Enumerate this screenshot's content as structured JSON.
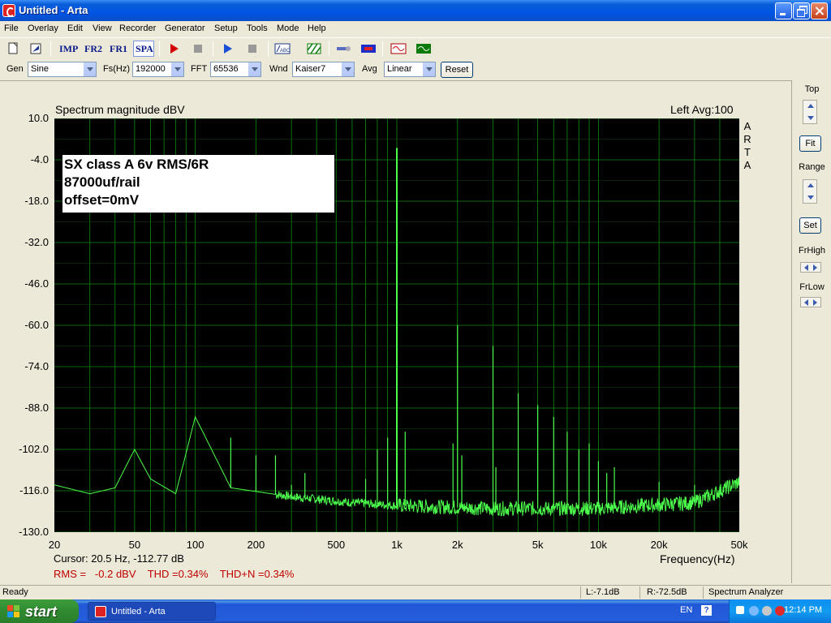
{
  "window": {
    "title": "Untitled - Arta"
  },
  "menu": [
    "File",
    "Overlay",
    "Edit",
    "View",
    "Recorder",
    "Generator",
    "Setup",
    "Tools",
    "Mode",
    "Help"
  ],
  "toolbar": {
    "imp": "IMP",
    "fr2": "FR2",
    "fr1": "FR1",
    "spa": "SPA"
  },
  "controls": {
    "gen_label": "Gen",
    "gen_value": "Sine",
    "fs_label": "Fs(Hz)",
    "fs_value": "192000",
    "fft_label": "FFT",
    "fft_value": "65536",
    "wnd_label": "Wnd",
    "wnd_value": "Kaiser7",
    "avg_label": "Avg",
    "avg_value": "Linear",
    "reset_label": "Reset"
  },
  "plot": {
    "title": "Spectrum magnitude dBV",
    "channel": "Left  Avg:100",
    "vertical_brand": [
      "A",
      "R",
      "T",
      "A"
    ],
    "overlay_lines": [
      "SX class A 6v RMS/6R",
      "87000uf/rail",
      "offset=0mV"
    ],
    "xlabel": "Frequency(Hz)",
    "cursor": "Cursor:    20.5 Hz, -112.77 dB",
    "measurements": "RMS =   -0.2 dBV    THD =0.34%    THD+N =0.34%"
  },
  "side": {
    "top": "Top",
    "fit": "Fit",
    "range": "Range",
    "set": "Set",
    "frhigh": "FrHigh",
    "frlow": "FrLow"
  },
  "status": {
    "ready": "Ready",
    "left": "L:-7.1dB",
    "right": "R:-72.5dB",
    "mode": "Spectrum Analyzer"
  },
  "taskbar": {
    "start": "start",
    "item": "Untitled - Arta",
    "lang": "EN",
    "clock": "12:14 PM"
  },
  "colors": {
    "plot_bg": "#000000",
    "grid": "#0f8a0f",
    "trace": "#4dff4d",
    "measure_text": "#c00000"
  },
  "chart_data": {
    "type": "line",
    "x_scale": "log",
    "xlim": [
      20,
      50000
    ],
    "ylim": [
      -130,
      10
    ],
    "y_ticks": [
      "10.0",
      "-4.0",
      "-18.0",
      "-32.0",
      "-46.0",
      "-60.0",
      "-74.0",
      "-88.0",
      "-102.0",
      "-116.0",
      "-130.0"
    ],
    "x_ticks": [
      "20",
      "50",
      "100",
      "200",
      "500",
      "1k",
      "2k",
      "5k",
      "10k",
      "20k",
      "50k"
    ],
    "grid": true,
    "noise_floor": [
      [
        20,
        -114
      ],
      [
        30,
        -117
      ],
      [
        40,
        -115
      ],
      [
        50,
        -102
      ],
      [
        60,
        -112
      ],
      [
        80,
        -117
      ],
      [
        100,
        -91
      ],
      [
        150,
        -115
      ],
      [
        300,
        -118
      ],
      [
        600,
        -120
      ],
      [
        1000,
        -121
      ],
      [
        3000,
        -122
      ],
      [
        10000,
        -122
      ],
      [
        30000,
        -120
      ],
      [
        50000,
        -113
      ]
    ],
    "peaks": [
      {
        "f": 100,
        "db": -91
      },
      {
        "f": 150,
        "db": -98
      },
      {
        "f": 200,
        "db": -104
      },
      {
        "f": 250,
        "db": -104
      },
      {
        "f": 300,
        "db": -114
      },
      {
        "f": 350,
        "db": -110
      },
      {
        "f": 700,
        "db": -112
      },
      {
        "f": 800,
        "db": -102
      },
      {
        "f": 900,
        "db": -98
      },
      {
        "f": 1000,
        "db": 0
      },
      {
        "f": 1100,
        "db": -96
      },
      {
        "f": 1900,
        "db": -100
      },
      {
        "f": 2000,
        "db": -60
      },
      {
        "f": 2100,
        "db": -104
      },
      {
        "f": 3000,
        "db": -67
      },
      {
        "f": 3100,
        "db": -108
      },
      {
        "f": 4000,
        "db": -83
      },
      {
        "f": 5000,
        "db": -87
      },
      {
        "f": 6000,
        "db": -91
      },
      {
        "f": 7000,
        "db": -96
      },
      {
        "f": 8000,
        "db": -102
      },
      {
        "f": 9000,
        "db": -100
      },
      {
        "f": 10000,
        "db": -106
      },
      {
        "f": 11000,
        "db": -110
      },
      {
        "f": 12000,
        "db": -108
      },
      {
        "f": 20000,
        "db": -113
      },
      {
        "f": 30000,
        "db": -114
      }
    ]
  }
}
